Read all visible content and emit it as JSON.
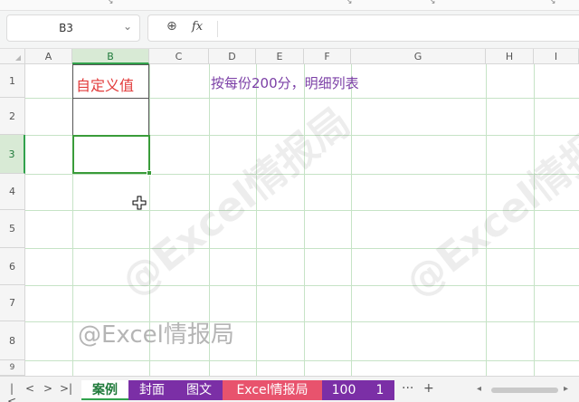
{
  "formula_bar": {
    "name_box": "B3",
    "fx_label": "fx",
    "formula": ""
  },
  "columns": [
    "A",
    "B",
    "C",
    "D",
    "E",
    "F",
    "G",
    "H",
    "I"
  ],
  "rows": [
    "1",
    "2",
    "3",
    "4",
    "5",
    "6",
    "7",
    "8",
    "9"
  ],
  "cells": {
    "B1": "自定义值",
    "D1": "按每份200分，明细列表"
  },
  "watermark": "@Excel情报局",
  "sheet_tabs": [
    {
      "label": "案例",
      "color": "#ffffff"
    },
    {
      "label": "封面",
      "color": "#7b2fa6"
    },
    {
      "label": "图文",
      "color": "#7b2fa6"
    },
    {
      "label": "Excel情报局",
      "color": "#e8536d"
    },
    {
      "label": "100",
      "color": "#7b2fa6"
    },
    {
      "label": "1",
      "color": "#7b2fa6"
    }
  ],
  "tab_nav": [
    "|<",
    "<",
    ">",
    ">|"
  ],
  "tab_more": "···",
  "tab_add": "+",
  "colors": {
    "accent_green": "#31a24c",
    "selection": "#3a9c3a",
    "red_text": "#e23b3b",
    "purple_text": "#7b3fa6"
  }
}
